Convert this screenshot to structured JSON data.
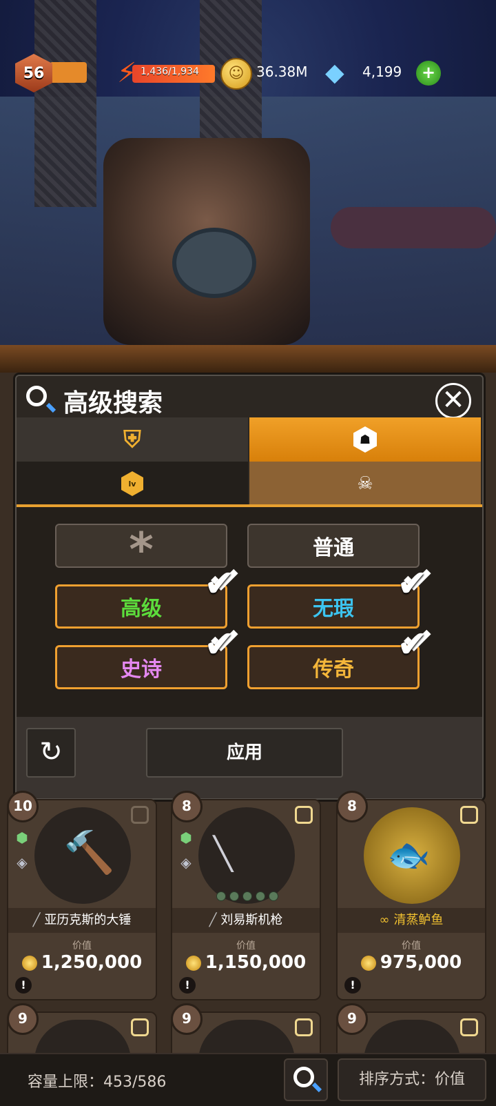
{
  "hud": {
    "level": "56",
    "energy": "1,436/1,934",
    "coins": "36.38M",
    "gems": "4,199",
    "plus": "+"
  },
  "dialog": {
    "title": "高级搜索",
    "close": "✕",
    "tabs": {
      "equipment_icon": "equipment-shield-icon",
      "rarity_icon": "rarity-hex-icon",
      "level_icon": "lv",
      "monster_icon": "monster-skull-icon"
    },
    "rarities": [
      {
        "label": "*",
        "selected": false
      },
      {
        "label": "普通",
        "selected": false
      },
      {
        "label": "高级",
        "selected": true,
        "color": "#5cdc3c"
      },
      {
        "label": "无瑕",
        "selected": true,
        "color": "#3cc4f0"
      },
      {
        "label": "史诗",
        "selected": true,
        "color": "#e488f0"
      },
      {
        "label": "传奇",
        "selected": true,
        "color": "#f4b63a"
      }
    ],
    "reset": "↻",
    "apply": "应用"
  },
  "items": [
    {
      "level": "10",
      "name": "亚历克斯的大锤",
      "value_label": "价值",
      "value": "1,250,000",
      "warn": "!"
    },
    {
      "level": "8",
      "name": "刘易斯机枪",
      "value_label": "价值",
      "value": "1,150,000",
      "warn": "!"
    },
    {
      "level": "8",
      "name": "清蒸鲈鱼",
      "value_label": "价值",
      "value": "975,000",
      "warn": "!"
    }
  ],
  "items_row2": [
    {
      "level": "9"
    },
    {
      "level": "9"
    },
    {
      "level": "9"
    }
  ],
  "bottom": {
    "capacity": "容量上限：453/586",
    "sort": "排序方式：价值"
  }
}
